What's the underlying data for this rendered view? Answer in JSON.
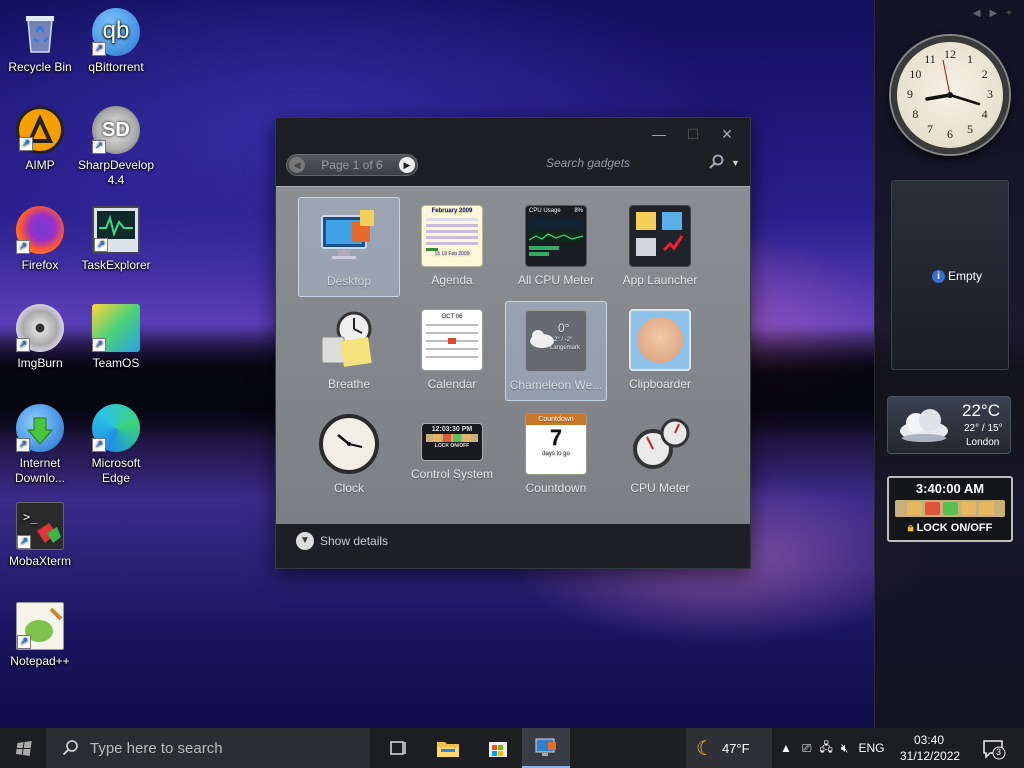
{
  "desktop": {
    "icons": [
      {
        "label": "Recycle Bin"
      },
      {
        "label": "qBittorrent"
      },
      {
        "label": "AIMP"
      },
      {
        "label": "SharpDevelop 4.4"
      },
      {
        "label": "Firefox"
      },
      {
        "label": "TaskExplorer"
      },
      {
        "label": "ImgBurn"
      },
      {
        "label": "TeamOS"
      },
      {
        "label": "Internet Downlo..."
      },
      {
        "label": "Microsoft Edge"
      },
      {
        "label": "MobaXterm"
      },
      {
        "label": "Notepad++"
      }
    ]
  },
  "gallery": {
    "page_label": "Page 1 of 6",
    "search_placeholder": "Search gadgets",
    "show_details": "Show details",
    "gadgets": [
      {
        "label": "Desktop"
      },
      {
        "label": "Agenda"
      },
      {
        "label": "All CPU Meter"
      },
      {
        "label": "App Launcher"
      },
      {
        "label": "Breathe"
      },
      {
        "label": "Calendar"
      },
      {
        "label": "Chameleon We..."
      },
      {
        "label": "Clipboarder"
      },
      {
        "label": "Clock"
      },
      {
        "label": "Control System"
      },
      {
        "label": "Countdown"
      },
      {
        "label": "CPU Meter"
      }
    ],
    "thumbs": {
      "agenda_header": "February 2009",
      "agenda_footer": "15 19 Feb 2009",
      "cpu_title": "CPU Usage",
      "cpu_value": "8%",
      "calendar_month": "OCT 06",
      "chameleon_temp": "0°",
      "chameleon_range": "2° / -2°",
      "chameleon_city": "Langemark",
      "control_time": "12:03:30 PM",
      "control_lock": "LOCK ON/OFF",
      "countdown_title": "Countdown",
      "countdown_days": "7",
      "countdown_sub": "days to go"
    }
  },
  "sidebar": {
    "empty_label": "Empty",
    "weather": {
      "temp": "22°C",
      "range": "22° / 15°",
      "city": "London"
    },
    "lock_gadget": {
      "time": "3:40:00 AM",
      "lock_label": "LOCK ON/OFF"
    },
    "clock_numbers": [
      "12",
      "1",
      "2",
      "3",
      "4",
      "5",
      "6",
      "7",
      "8",
      "9",
      "10",
      "11"
    ]
  },
  "taskbar": {
    "search_placeholder": "Type here to search",
    "weather_temp": "47°F",
    "language": "ENG",
    "time": "03:40",
    "date": "31/12/2022",
    "notification_count": "3"
  }
}
